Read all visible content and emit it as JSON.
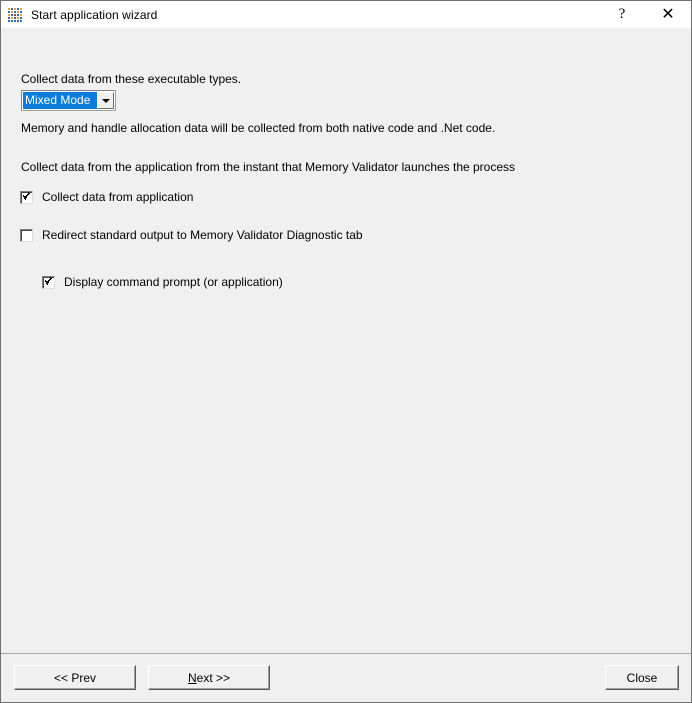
{
  "window": {
    "title": "Start application wizard",
    "icon": "app-grid-icon",
    "background_color": "#f0f0f0",
    "border_color": "#6f6f6f"
  },
  "titlebar": {
    "help_label": "?",
    "close_label": "✕"
  },
  "main": {
    "executable_types_label": "Collect data from these executable types.",
    "combo": {
      "selected_value": "Mixed Mode",
      "options": [
        "Mixed Mode"
      ],
      "highlight_color": "#0a7cdb",
      "arrow_icon": "chevron-down-icon"
    },
    "description_label": "Memory and handle allocation data will be collected from both native code and .Net code.",
    "instant_label": "Collect data from the application from the instant that Memory Validator launches the process",
    "checkboxes": [
      {
        "label": "Collect data from application",
        "checked": true
      },
      {
        "label": "Redirect standard output to Memory Validator Diagnostic tab",
        "checked": false
      },
      {
        "label": "Display command prompt (or application)",
        "checked": true
      }
    ]
  },
  "footer": {
    "prev_label": "<< Prev",
    "next_accel": "N",
    "next_rest": "ext >>",
    "close_label": "Close"
  }
}
